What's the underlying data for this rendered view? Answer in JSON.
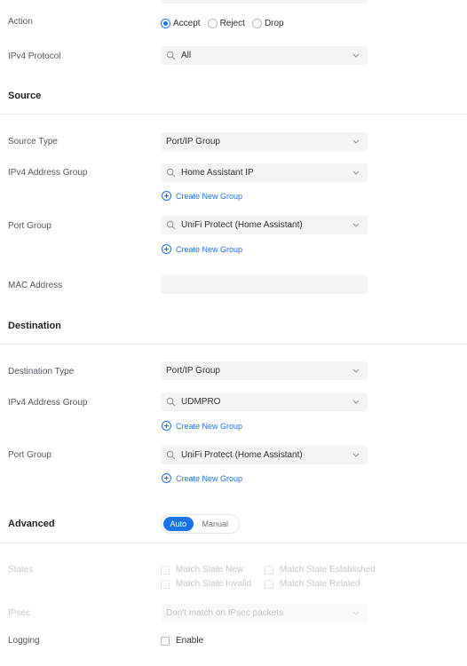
{
  "action": {
    "label": "Action",
    "options": [
      {
        "label": "Accept",
        "selected": true
      },
      {
        "label": "Reject",
        "selected": false
      },
      {
        "label": "Drop",
        "selected": false
      }
    ]
  },
  "ipv4_protocol": {
    "label": "IPv4 Protocol",
    "value": "All"
  },
  "source": {
    "title": "Source",
    "type_label": "Source Type",
    "type_value": "Port/IP Group",
    "address_group_label": "IPv4 Address Group",
    "address_group_value": "Home Assistant IP",
    "create_group_1": "Create New Group",
    "port_group_label": "Port Group",
    "port_group_value": "UniFi Protect (Home Assistant)",
    "create_group_2": "Create New Group",
    "mac_label": "MAC Address",
    "mac_value": ""
  },
  "destination": {
    "title": "Destination",
    "type_label": "Destination Type",
    "type_value": "Port/IP Group",
    "address_group_label": "IPv4 Address Group",
    "address_group_value": "UDMPRO",
    "create_group_1": "Create New Group",
    "port_group_label": "Port Group",
    "port_group_value": "UniFi Protect (Home Assistant)",
    "create_group_2": "Create New Group"
  },
  "advanced": {
    "title": "Advanced",
    "toggle_auto": "Auto",
    "toggle_manual": "Manual",
    "states_label": "States",
    "states": {
      "new": "Match State New",
      "established": "Match State Established",
      "invalid": "Match State Invalid",
      "related": "Match State Related"
    },
    "ipsec_label": "IPsec",
    "ipsec_value": "Don't match on IPsec packets",
    "logging_label": "Logging",
    "logging_enable": "Enable"
  },
  "colors": {
    "accent": "#1a73e8",
    "field_bg": "#f3f4f6",
    "disabled_text": "#c3c7cc"
  }
}
